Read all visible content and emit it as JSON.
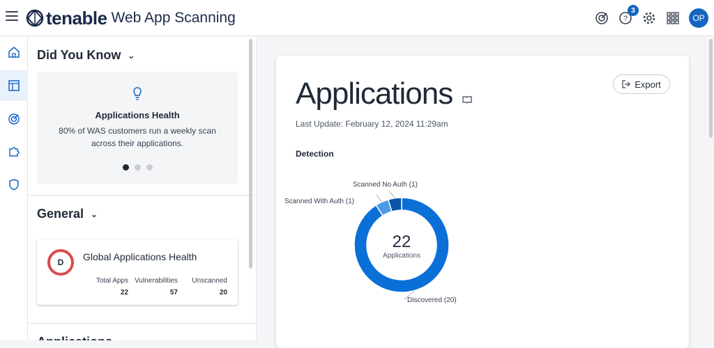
{
  "topbar": {
    "brand": "tenable",
    "product": "Web App Scanning",
    "help_badge": "3",
    "avatar_initials": "OP"
  },
  "did_you_know": {
    "title": "Did You Know",
    "card_title": "Applications Health",
    "card_body": "80% of WAS customers run a weekly scan across their applications."
  },
  "general": {
    "title": "General",
    "card_title": "Global Applications Health",
    "grade": "D",
    "stats": [
      {
        "label": "Total Apps",
        "value": "22"
      },
      {
        "label": "Vulnerabilities",
        "value": "57"
      },
      {
        "label": "Unscanned",
        "value": "20"
      }
    ]
  },
  "next_section_title": "Applications",
  "main": {
    "title": "Applications",
    "last_update": "Last Update: February 12, 2024 11:29am",
    "export_label": "Export",
    "detection_label": "Detection"
  },
  "chart_data": {
    "type": "pie",
    "donut": true,
    "center_value": "22",
    "center_label": "Applications",
    "slices": [
      {
        "label": "Discovered (20)",
        "value": 20,
        "color": "#0b6fd8"
      },
      {
        "label": "Scanned With Auth (1)",
        "value": 1,
        "color": "#4d9be8"
      },
      {
        "label": "Scanned No Auth (1)",
        "value": 1,
        "color": "#0a55a8"
      }
    ]
  }
}
